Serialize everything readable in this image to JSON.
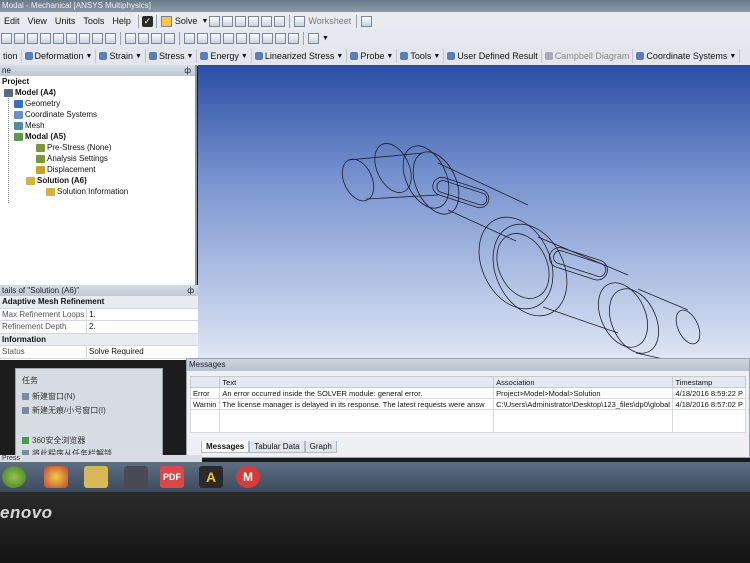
{
  "window": {
    "title": "Modal - Mechanical [ANSYS Multiphysics]"
  },
  "menu": {
    "items": [
      "Edit",
      "View",
      "Units",
      "Tools",
      "Help"
    ]
  },
  "toolbar": {
    "solve_label": "Solve",
    "worksheet_label": "Worksheet"
  },
  "context_toolbar": {
    "items": [
      {
        "label": "tion",
        "icon": "solution-icon"
      },
      {
        "label": "Deformation",
        "icon": "deformation-icon"
      },
      {
        "label": "Strain",
        "icon": "strain-icon"
      },
      {
        "label": "Stress",
        "icon": "stress-icon"
      },
      {
        "label": "Energy",
        "icon": "energy-icon"
      },
      {
        "label": "Linearized Stress",
        "icon": "linearized-stress-icon"
      },
      {
        "label": "Probe",
        "icon": "probe-icon"
      },
      {
        "label": "Tools",
        "icon": "tools-icon"
      },
      {
        "label": "User Defined Result",
        "icon": "user-defined-result-icon"
      },
      {
        "label": "Campbell Diagram",
        "icon": "campbell-diagram-icon"
      },
      {
        "label": "Coordinate Systems",
        "icon": "coordinate-systems-icon"
      }
    ]
  },
  "outline": {
    "header": "ne",
    "root": "Project",
    "items": [
      {
        "label": "Model (A4)",
        "bold": true
      },
      {
        "label": "Geometry",
        "bold": false
      },
      {
        "label": "Coordinate Systems",
        "bold": false
      },
      {
        "label": "Mesh",
        "bold": false
      },
      {
        "label": "Modal (A5)",
        "bold": true
      },
      {
        "label": "Pre-Stress (None)",
        "bold": false
      },
      {
        "label": "Analysis Settings",
        "bold": false
      },
      {
        "label": "Displacement",
        "bold": false
      },
      {
        "label": "Solution (A6)",
        "bold": true
      },
      {
        "label": "Solution Information",
        "bold": false
      }
    ]
  },
  "details": {
    "header": "tails of \"Solution (A6)\"",
    "group1": "Adaptive Mesh Refinement",
    "rows1": [
      {
        "key": "Max Refinement Loops",
        "value": "1."
      },
      {
        "key": "Refinement Depth",
        "value": "2."
      }
    ],
    "group2": "Information",
    "rows2": [
      {
        "key": "Status",
        "value": "Solve Required"
      }
    ]
  },
  "messages": {
    "header": "Messages",
    "columns": [
      "",
      "Text",
      "Association",
      "Timestamp"
    ],
    "rows": [
      [
        "Error",
        "An error occurred inside the SOLVER module: general error.",
        "Project>Model>Modal>Solution",
        "4/18/2016 8:59:22 P"
      ],
      [
        "Warnin",
        "The license manager is delayed in its response. The latest requests were answ",
        "C:\\Users\\Administrator\\Desktop\\123_files\\dp0\\global",
        "4/18/2016 8:57:02 P"
      ]
    ],
    "tabs": [
      "Messages",
      "Tabular Data",
      "Graph"
    ]
  },
  "popup": {
    "title": "任务",
    "items": [
      "新建窗口(N)",
      "新建无痕/小号窗口(I)"
    ],
    "footer_items": [
      "360安全浏览器",
      "将此程序从任务栏解锁"
    ]
  },
  "status": {
    "text": "Press"
  },
  "taskbar": {
    "icons": [
      {
        "name": "chrome-icon",
        "label": ""
      },
      {
        "name": "folder-icon",
        "label": ""
      },
      {
        "name": "media-icon",
        "label": ""
      },
      {
        "name": "game-icon",
        "label": ""
      },
      {
        "name": "pdf-icon",
        "label": "PDF"
      },
      {
        "name": "ansys-icon",
        "label": "A"
      },
      {
        "name": "m-icon",
        "label": "M"
      }
    ]
  },
  "bezel": {
    "brand": "enovo"
  },
  "colors": {
    "graphics_top": "#2c4fa5",
    "graphics_bottom": "#dfe6f4",
    "error": "#c0392b"
  }
}
